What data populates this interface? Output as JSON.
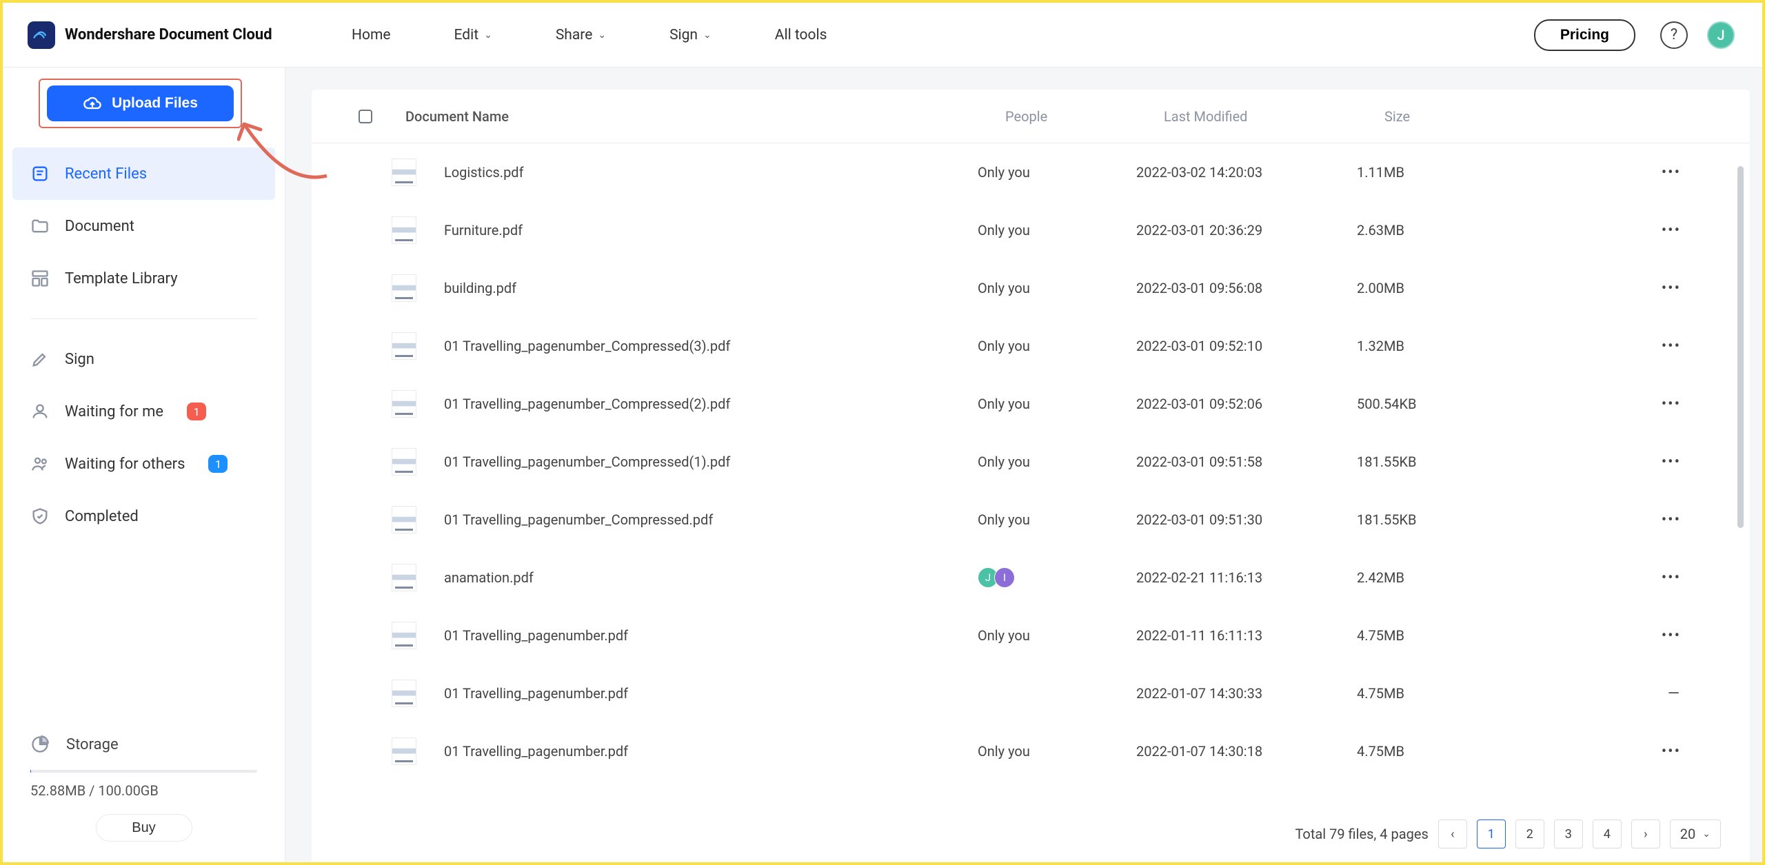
{
  "brand": "Wondershare Document Cloud",
  "nav": {
    "home": "Home",
    "edit": "Edit",
    "share": "Share",
    "sign": "Sign",
    "all_tools": "All tools"
  },
  "header": {
    "pricing": "Pricing",
    "avatar_initial": "J"
  },
  "sidebar": {
    "upload": "Upload Files",
    "items": [
      {
        "label": "Recent Files"
      },
      {
        "label": "Document"
      },
      {
        "label": "Template Library"
      }
    ],
    "sign": "Sign",
    "waiting_me": "Waiting for me",
    "waiting_me_badge": "1",
    "waiting_others": "Waiting for others",
    "waiting_others_badge": "1",
    "completed": "Completed",
    "storage_label": "Storage",
    "storage_text": "52.88MB / 100.00GB",
    "buy": "Buy"
  },
  "table": {
    "headers": {
      "name": "Document Name",
      "people": "People",
      "modified": "Last Modified",
      "size": "Size"
    },
    "rows": [
      {
        "name": "Logistics.pdf",
        "people": "Only you",
        "modified": "2022-03-02 14:20:03",
        "size": "1.11MB",
        "actions": "more"
      },
      {
        "name": "Furniture.pdf",
        "people": "Only you",
        "modified": "2022-03-01 20:36:29",
        "size": "2.63MB",
        "actions": "more"
      },
      {
        "name": "building.pdf",
        "people": "Only you",
        "modified": "2022-03-01 09:56:08",
        "size": "2.00MB",
        "actions": "more"
      },
      {
        "name": "01 Travelling_pagenumber_Compressed(3).pdf",
        "people": "Only you",
        "modified": "2022-03-01 09:52:10",
        "size": "1.32MB",
        "actions": "more"
      },
      {
        "name": "01 Travelling_pagenumber_Compressed(2).pdf",
        "people": "Only you",
        "modified": "2022-03-01 09:52:06",
        "size": "500.54KB",
        "actions": "more"
      },
      {
        "name": "01 Travelling_pagenumber_Compressed(1).pdf",
        "people": "Only you",
        "modified": "2022-03-01 09:51:58",
        "size": "181.55KB",
        "actions": "more"
      },
      {
        "name": "01 Travelling_pagenumber_Compressed.pdf",
        "people": "Only you",
        "modified": "2022-03-01 09:51:30",
        "size": "181.55KB",
        "actions": "more"
      },
      {
        "name": "anamation.pdf",
        "people": "avatars",
        "modified": "2022-02-21 11:16:13",
        "size": "2.42MB",
        "actions": "more",
        "avatar_initials": [
          "J",
          "I"
        ]
      },
      {
        "name": "01 Travelling_pagenumber.pdf",
        "people": "Only you",
        "modified": "2022-01-11 16:11:13",
        "size": "4.75MB",
        "actions": "more"
      },
      {
        "name": "01 Travelling_pagenumber.pdf",
        "people": "",
        "modified": "2022-01-07 14:30:33",
        "size": "4.75MB",
        "actions": "dash"
      },
      {
        "name": "01 Travelling_pagenumber.pdf",
        "people": "Only you",
        "modified": "2022-01-07 14:30:18",
        "size": "4.75MB",
        "actions": "more"
      }
    ]
  },
  "pagination": {
    "summary": "Total 79 files, 4 pages",
    "pages": [
      "1",
      "2",
      "3",
      "4"
    ],
    "page_size": "20"
  }
}
